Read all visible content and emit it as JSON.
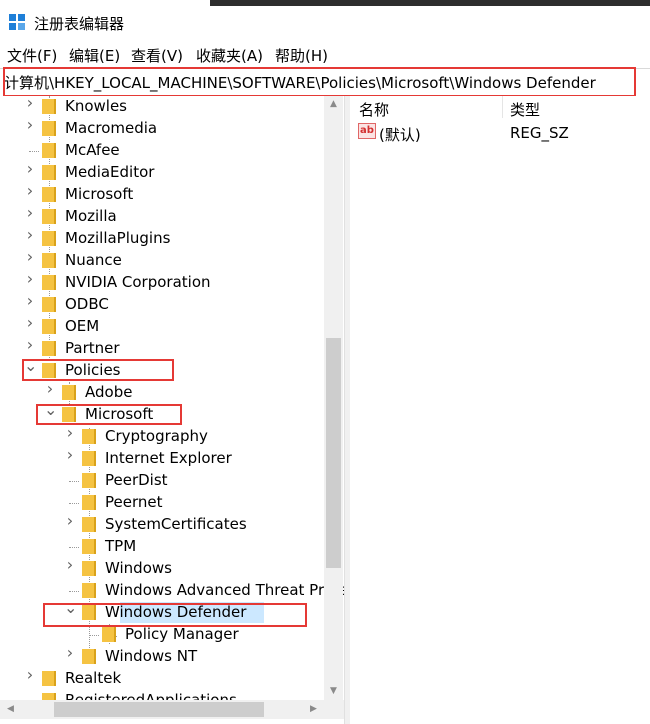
{
  "window": {
    "title": "注册表编辑器",
    "icon": "registry-editor-icon"
  },
  "menu": [
    "文件(F)",
    "编辑(E)",
    "查看(V)",
    "收藏夹(A)",
    "帮助(H)"
  ],
  "address": "计算机\\HKEY_LOCAL_MACHINE\\SOFTWARE\\Policies\\Microsoft\\Windows Defender",
  "tree": [
    {
      "label": "Knowles",
      "expander": "collapsed"
    },
    {
      "label": "Macromedia",
      "expander": "collapsed"
    },
    {
      "label": "McAfee",
      "expander": "none"
    },
    {
      "label": "MediaEditor",
      "expander": "collapsed"
    },
    {
      "label": "Microsoft",
      "expander": "collapsed"
    },
    {
      "label": "Mozilla",
      "expander": "collapsed"
    },
    {
      "label": "MozillaPlugins",
      "expander": "collapsed"
    },
    {
      "label": "Nuance",
      "expander": "collapsed"
    },
    {
      "label": "NVIDIA Corporation",
      "expander": "collapsed"
    },
    {
      "label": "ODBC",
      "expander": "collapsed"
    },
    {
      "label": "OEM",
      "expander": "collapsed"
    },
    {
      "label": "Partner",
      "expander": "collapsed"
    },
    {
      "label": "Policies",
      "expander": "expanded"
    },
    {
      "label": "Adobe",
      "expander": "collapsed"
    },
    {
      "label": "Microsoft",
      "expander": "expanded"
    },
    {
      "label": "Cryptography",
      "expander": "collapsed"
    },
    {
      "label": "Internet Explorer",
      "expander": "collapsed"
    },
    {
      "label": "PeerDist",
      "expander": "none"
    },
    {
      "label": "Peernet",
      "expander": "none"
    },
    {
      "label": "SystemCertificates",
      "expander": "collapsed"
    },
    {
      "label": "TPM",
      "expander": "none"
    },
    {
      "label": "Windows",
      "expander": "collapsed"
    },
    {
      "label": "Windows Advanced Threat Protection",
      "expander": "none"
    },
    {
      "label": "Windows Defender",
      "expander": "expanded",
      "selected": true
    },
    {
      "label": "Policy Manager",
      "expander": "none"
    },
    {
      "label": "Windows NT",
      "expander": "collapsed"
    },
    {
      "label": "Realtek",
      "expander": "collapsed"
    },
    {
      "label": "RegisteredApplications",
      "expander": "none"
    }
  ],
  "values_pane": {
    "columns": [
      "名称",
      "类型"
    ],
    "rows": [
      {
        "name": "(默认)",
        "type": "REG_SZ",
        "icon": "string-value-icon"
      }
    ]
  },
  "colors": {
    "highlight_box": "#e53935",
    "selection": "#cce8ff",
    "folder": "#f5c342"
  }
}
